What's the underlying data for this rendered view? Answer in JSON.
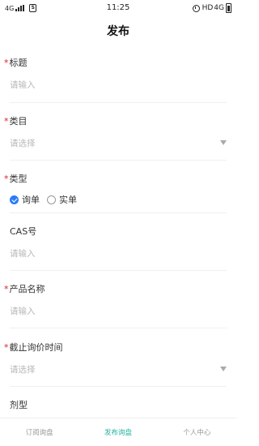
{
  "status_bar": {
    "network": "4G",
    "sim_icon_text": "S",
    "time": "11:25",
    "hd": "HD",
    "network_right": "4G"
  },
  "header": {
    "title": "发布"
  },
  "form": {
    "title_field": {
      "label": "标题",
      "placeholder": "请输入"
    },
    "category_field": {
      "label": "类目",
      "placeholder": "请选择"
    },
    "type_field": {
      "label": "类型",
      "options": [
        {
          "label": "询单",
          "checked": true
        },
        {
          "label": "实单",
          "checked": false
        }
      ]
    },
    "cas_field": {
      "label": "CAS号",
      "placeholder": "请输入"
    },
    "product_name_field": {
      "label": "产品名称",
      "placeholder": "请输入"
    },
    "deadline_field": {
      "label": "截止询价时间",
      "placeholder": "请选择"
    },
    "dosage_field": {
      "label": "剂型"
    }
  },
  "tab_bar": {
    "tabs": [
      {
        "label": "订阅询盘",
        "active": false
      },
      {
        "label": "发布询盘",
        "active": true
      },
      {
        "label": "个人中心",
        "active": false
      }
    ]
  },
  "colors": {
    "required_star": "#e02020",
    "radio_checked": "#2b7cf6",
    "tab_active": "#23b3a0",
    "placeholder": "#b8b8b8"
  }
}
